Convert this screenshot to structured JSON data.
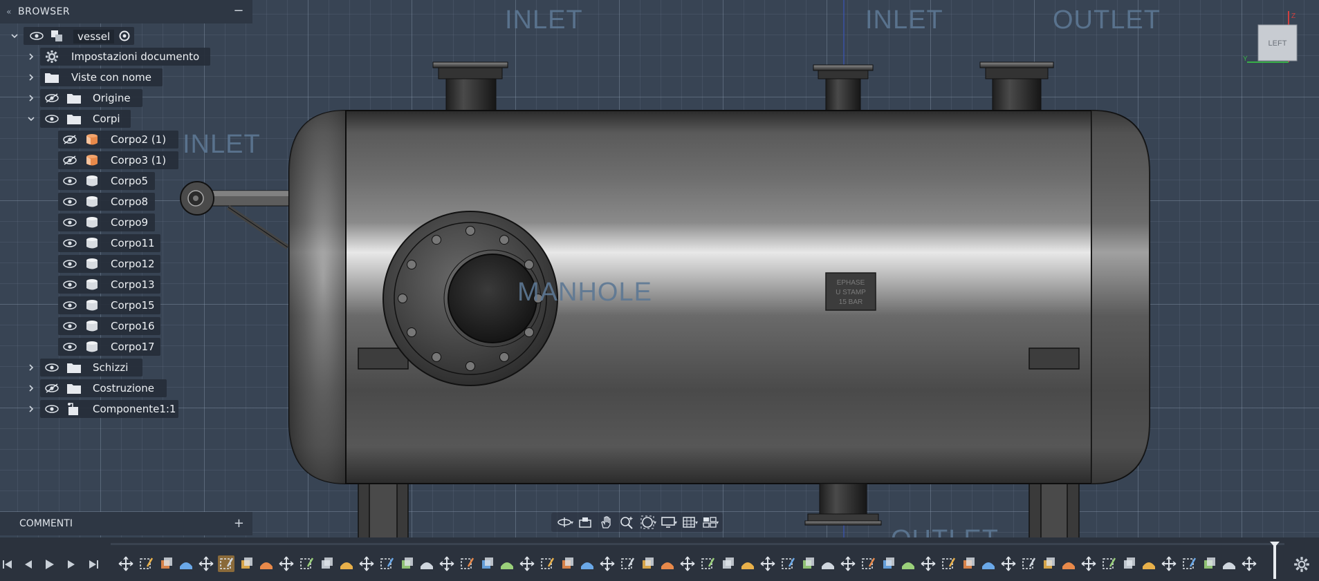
{
  "browser": {
    "title": "BROWSER",
    "collapse_glyph": "«",
    "minimize_glyph": "−",
    "root": {
      "name": "vessel"
    },
    "items": [
      {
        "label": "Impostazioni documento",
        "icon": "gear-icon",
        "expandable": true,
        "visible": null
      },
      {
        "label": "Viste con nome",
        "icon": "folder-icon",
        "expandable": true,
        "visible": null
      },
      {
        "label": "Origine",
        "icon": "folder-icon",
        "expandable": true,
        "visible": false
      },
      {
        "label": "Corpi",
        "icon": "folder-icon",
        "expandable": true,
        "expanded": true,
        "visible": true
      },
      {
        "label": "Corpo2 (1)",
        "icon": "body-orange-icon",
        "visible": false
      },
      {
        "label": "Corpo3 (1)",
        "icon": "body-orange-icon",
        "visible": false
      },
      {
        "label": "Corpo5",
        "icon": "body-icon",
        "visible": true
      },
      {
        "label": "Corpo8",
        "icon": "body-icon",
        "visible": true
      },
      {
        "label": "Corpo9",
        "icon": "body-icon",
        "visible": true
      },
      {
        "label": "Corpo11",
        "icon": "body-icon",
        "visible": true
      },
      {
        "label": "Corpo12",
        "icon": "body-icon",
        "visible": true
      },
      {
        "label": "Corpo13",
        "icon": "body-icon",
        "visible": true
      },
      {
        "label": "Corpo15",
        "icon": "body-icon",
        "visible": true
      },
      {
        "label": "Corpo16",
        "icon": "body-icon",
        "visible": true
      },
      {
        "label": "Corpo17",
        "icon": "body-icon",
        "visible": true
      },
      {
        "label": "Schizzi",
        "icon": "folder-icon",
        "expandable": true,
        "visible": true
      },
      {
        "label": "Costruzione",
        "icon": "folder-icon",
        "expandable": true,
        "visible": false
      },
      {
        "label": "Componente1:1",
        "icon": "component-icon",
        "expandable": true,
        "visible": true
      }
    ]
  },
  "comments": {
    "title": "COMMENTI",
    "add_glyph": "+"
  },
  "viewport": {
    "labels": {
      "inlet_1": "INLET",
      "inlet_2": "INLET",
      "outlet_1": "OUTLET",
      "inlet_side": "INLET",
      "manhole": "MANHOLE",
      "outlet_bottom": "OUTLET"
    },
    "nameplate": [
      "EPHASE",
      "U STAMP",
      "15 BAR"
    ],
    "viewcube": {
      "face": "LEFT",
      "axis_y": "Y",
      "axis_z": "Z"
    }
  },
  "nav_toolbar": {
    "buttons": [
      "orbit-icon",
      "look-at-icon",
      "pan-icon",
      "zoom-icon",
      "fit-icon",
      "display-settings-icon",
      "grid-icon",
      "viewports-icon"
    ]
  },
  "timeline": {
    "controls": [
      "skip-start-icon",
      "step-back-icon",
      "play-icon",
      "step-forward-icon",
      "skip-end-icon"
    ],
    "feature_count": 57
  },
  "colors": {
    "panel": "#2e3744",
    "viewport": "#384454",
    "label": "#5d7894",
    "accent_orange": "#e8894a"
  }
}
